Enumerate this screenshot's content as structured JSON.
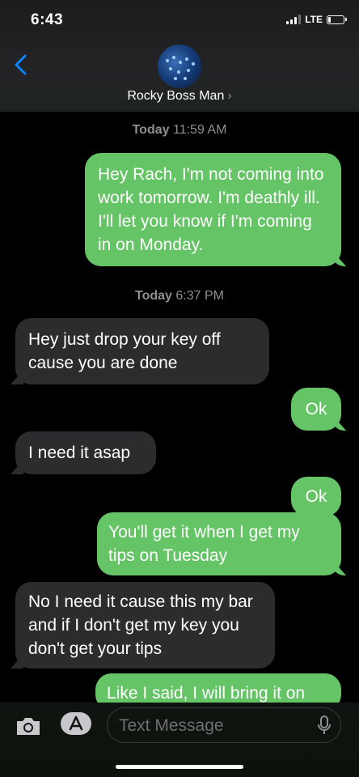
{
  "status": {
    "time": "6:43",
    "network": "LTE",
    "signal_bars": 3,
    "battery_percent": 20
  },
  "header": {
    "contact_name": "Rocky Boss Man",
    "chevron": "›"
  },
  "thread": {
    "timestamps": [
      {
        "day": "Today",
        "time": "11:59 AM"
      },
      {
        "day": "Today",
        "time": "6:37 PM"
      }
    ],
    "messages": [
      {
        "from": "me",
        "text": "Hey Rach, I'm not coming into work tomorrow. I'm deathly ill. I'll let you know if I'm coming in on Monday."
      },
      {
        "from": "them",
        "text": "Hey just  drop your key off cause you are done"
      },
      {
        "from": "me",
        "text": "Ok"
      },
      {
        "from": "them",
        "text": "I need  it asap"
      },
      {
        "from": "me",
        "text": "Ok"
      },
      {
        "from": "me",
        "text": "You'll get it when I get my tips on Tuesday"
      },
      {
        "from": "them",
        "text": "No I need it cause this my bar and if I don't get my key you don't get your tips"
      },
      {
        "from": "me",
        "text": "Like I said, I will bring it on"
      }
    ]
  },
  "composer": {
    "placeholder": "Text Message"
  },
  "colors": {
    "sent_bubble": "#65c466",
    "received_bubble": "#2c2c2e",
    "accent_blue": "#0a84ff"
  },
  "icons": {
    "back": "chevron-left-icon",
    "camera": "camera-icon",
    "apps": "app-store-icon",
    "mic": "microphone-icon"
  }
}
